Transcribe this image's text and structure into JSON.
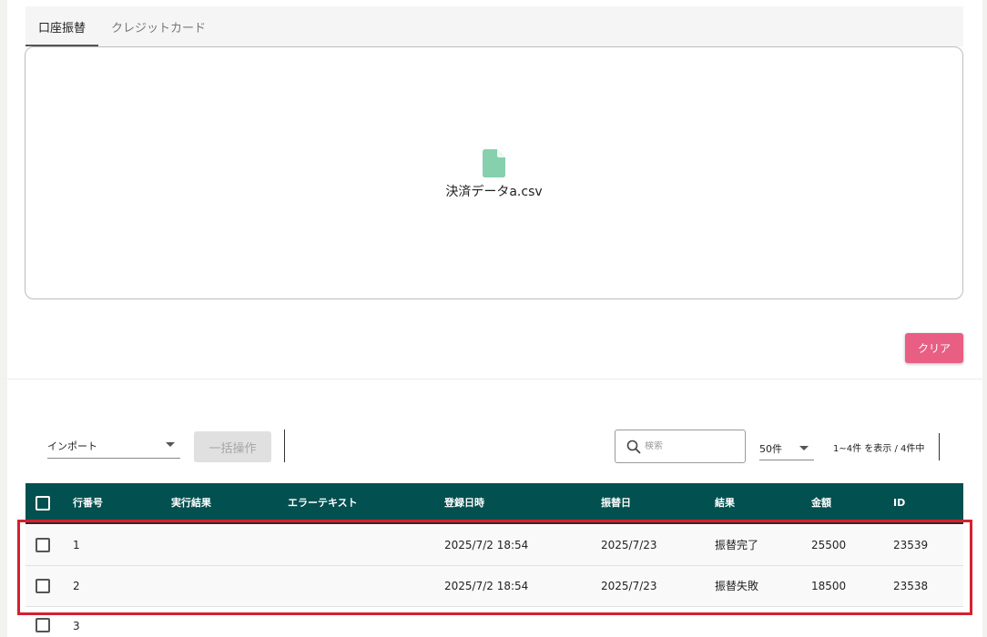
{
  "tabs": [
    {
      "label": "口座振替",
      "active": true
    },
    {
      "label": "クレジットカード",
      "active": false
    }
  ],
  "upload": {
    "file_name": "決済データa.csv"
  },
  "clear_label": "クリア",
  "toolbar": {
    "import_select": "インポート",
    "bulk_label": "一括操作",
    "search_placeholder": "検索",
    "per_page": "50件",
    "range_text": "1~4件 を表示 / 4件中"
  },
  "table": {
    "columns": [
      "行番号",
      "実行結果",
      "エラーテキスト",
      "登録日時",
      "振替日",
      "結果",
      "金額",
      "ID"
    ],
    "rows": [
      {
        "no": "1",
        "exec": "",
        "error": "",
        "registered": "2025/7/2 18:54",
        "transfer": "2025/7/23",
        "result": "振替完了",
        "amount": "25500",
        "id": "23539"
      },
      {
        "no": "2",
        "exec": "",
        "error": "",
        "registered": "2025/7/2 18:54",
        "transfer": "2025/7/23",
        "result": "振替失敗",
        "amount": "18500",
        "id": "23538"
      },
      {
        "no": "3",
        "exec": "",
        "error": "",
        "registered": "",
        "transfer": "",
        "result": "",
        "amount": "",
        "id": ""
      }
    ]
  },
  "colors": {
    "header_bg": "#02504f",
    "accent_pink": "#e95f84",
    "file_icon": "#86d0ad",
    "highlight": "#d62030"
  }
}
